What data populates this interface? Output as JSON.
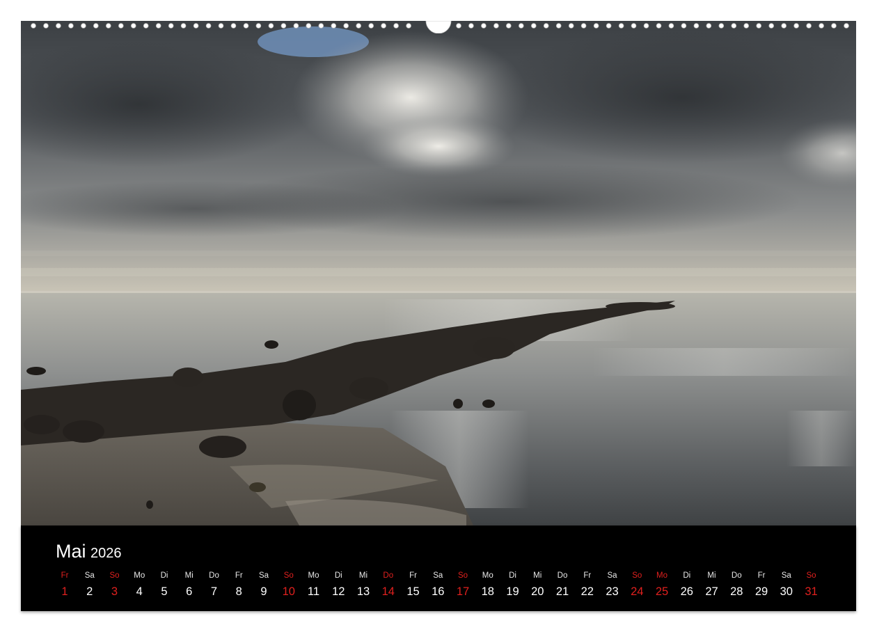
{
  "calendar": {
    "month": "Mai",
    "year": "2026",
    "holiday_color": "#e0201e",
    "days": [
      {
        "wd": "Fr",
        "d": "1",
        "red": true
      },
      {
        "wd": "Sa",
        "d": "2",
        "red": false
      },
      {
        "wd": "So",
        "d": "3",
        "red": true
      },
      {
        "wd": "Mo",
        "d": "4",
        "red": false
      },
      {
        "wd": "Di",
        "d": "5",
        "red": false
      },
      {
        "wd": "Mi",
        "d": "6",
        "red": false
      },
      {
        "wd": "Do",
        "d": "7",
        "red": false
      },
      {
        "wd": "Fr",
        "d": "8",
        "red": false
      },
      {
        "wd": "Sa",
        "d": "9",
        "red": false
      },
      {
        "wd": "So",
        "d": "10",
        "red": true
      },
      {
        "wd": "Mo",
        "d": "11",
        "red": false
      },
      {
        "wd": "Di",
        "d": "12",
        "red": false
      },
      {
        "wd": "Mi",
        "d": "13",
        "red": false
      },
      {
        "wd": "Do",
        "d": "14",
        "red": true
      },
      {
        "wd": "Fr",
        "d": "15",
        "red": false
      },
      {
        "wd": "Sa",
        "d": "16",
        "red": false
      },
      {
        "wd": "So",
        "d": "17",
        "red": true
      },
      {
        "wd": "Mo",
        "d": "18",
        "red": false
      },
      {
        "wd": "Di",
        "d": "19",
        "red": false
      },
      {
        "wd": "Mi",
        "d": "20",
        "red": false
      },
      {
        "wd": "Do",
        "d": "21",
        "red": false
      },
      {
        "wd": "Fr",
        "d": "22",
        "red": false
      },
      {
        "wd": "Sa",
        "d": "23",
        "red": false
      },
      {
        "wd": "So",
        "d": "24",
        "red": true
      },
      {
        "wd": "Mo",
        "d": "25",
        "red": true
      },
      {
        "wd": "Di",
        "d": "26",
        "red": false
      },
      {
        "wd": "Mi",
        "d": "27",
        "red": false
      },
      {
        "wd": "Do",
        "d": "28",
        "red": false
      },
      {
        "wd": "Fr",
        "d": "29",
        "red": false
      },
      {
        "wd": "Sa",
        "d": "30",
        "red": false
      },
      {
        "wd": "So",
        "d": "31",
        "red": true
      }
    ]
  }
}
